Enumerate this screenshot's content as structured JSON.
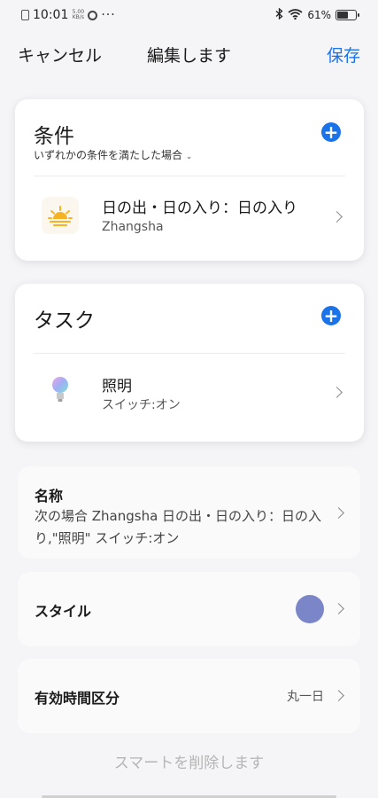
{
  "status_bar": {
    "time": "10:01",
    "speed": "5.00 KB/s",
    "more": "···",
    "battery": "61%",
    "battery_level": 0.61,
    "icons": [
      "sim-icon",
      "app-notification-icon",
      "bluetooth-icon",
      "wifi-icon",
      "battery-icon"
    ]
  },
  "header": {
    "cancel_label": "キャンセル",
    "title": "編集します",
    "save_label": "保存"
  },
  "conditions": {
    "title": "条件",
    "subtitle": "いずれかの条件を満たした場合",
    "items": [
      {
        "title": "日の出・日の入り：日の入り",
        "subtitle": "Zhangsha",
        "icon": "sunset-icon"
      }
    ]
  },
  "tasks": {
    "title": "タスク",
    "items": [
      {
        "title": "照明",
        "subtitle": "スイッチ:オン",
        "icon": "light-bulb-icon"
      }
    ]
  },
  "settings": {
    "name_label": "名称",
    "name_value": "次の場合 Zhangsha 日の出・日の入り：日の入り,\"照明\" スイッチ:オン",
    "style_label": "スタイル",
    "style_color": "#7b86c8",
    "duration_label": "有効時間区分",
    "duration_value": "丸一日"
  },
  "delete_label": "スマートを削除します",
  "colors": {
    "accent": "#1a73e8",
    "sunset": "#f5b324"
  }
}
